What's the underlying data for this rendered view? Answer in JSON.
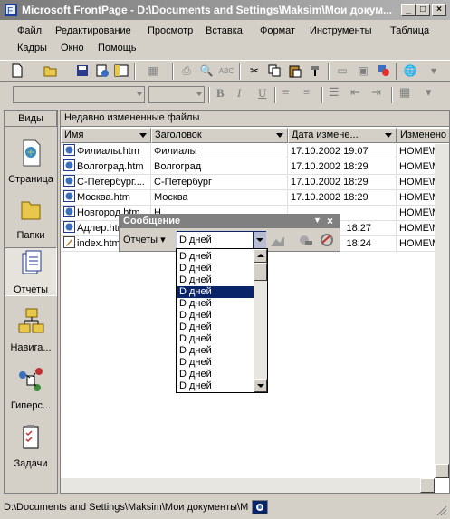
{
  "window": {
    "title": "Microsoft FrontPage - D:\\Documents and Settings\\Maksim\\Мои докум..."
  },
  "menu": [
    "Файл",
    "Редактирование",
    "Просмотр",
    "Вставка",
    "Формат",
    "Инструменты",
    "Таблица",
    "Кадры",
    "Окно",
    "Помощь"
  ],
  "views": {
    "header": "Виды",
    "items": [
      "Страница",
      "Папки",
      "Отчеты",
      "Навига...",
      "Гиперс...",
      "Задачи"
    ]
  },
  "panel": {
    "title": "Недавно измененные файлы",
    "columns": [
      "Имя",
      "Заголовок",
      "Дата измене...",
      "Изменено"
    ],
    "rows": [
      {
        "name": "Филиалы.htm",
        "title": "Филиалы",
        "date": "17.10.2002 19:07",
        "by": "HOME\\Maks"
      },
      {
        "name": "Волгоград.htm",
        "title": "Волгоград",
        "date": "17.10.2002 18:29",
        "by": "HOME\\Maks"
      },
      {
        "name": "С-Петербург....",
        "title": "С-Петербург",
        "date": "17.10.2002 18:29",
        "by": "HOME\\Maks"
      },
      {
        "name": "Москва.htm",
        "title": "Москва",
        "date": "17.10.2002 18:29",
        "by": "HOME\\Maks"
      },
      {
        "name": "Новгород.htm",
        "title": "Н",
        "date": "",
        "by": "HOME\\Maks"
      },
      {
        "name": "Адлер.htm",
        "title": "",
        "date": "18:27",
        "by": "HOME\\Maks"
      },
      {
        "name": "index.htm",
        "title": "",
        "date": "18:24",
        "by": "HOME\\Maks"
      }
    ]
  },
  "message_toolbar": {
    "title": "Сообщение",
    "reports_label": "Отчеты",
    "combo_value": "D дней"
  },
  "dropdown": {
    "items": [
      "D дней",
      "D дней",
      "D дней",
      "D дней",
      "D дней",
      "D дней",
      "D дней",
      "D дней",
      "D дней",
      "D дней",
      "D дней",
      "D дней"
    ],
    "selected_index": 3
  },
  "status": {
    "text": "D:\\Documents and Settings\\Maksim\\Мои документы\\Мо"
  },
  "colors": {
    "selection": "#0a246a",
    "face": "#d4d0c8"
  }
}
